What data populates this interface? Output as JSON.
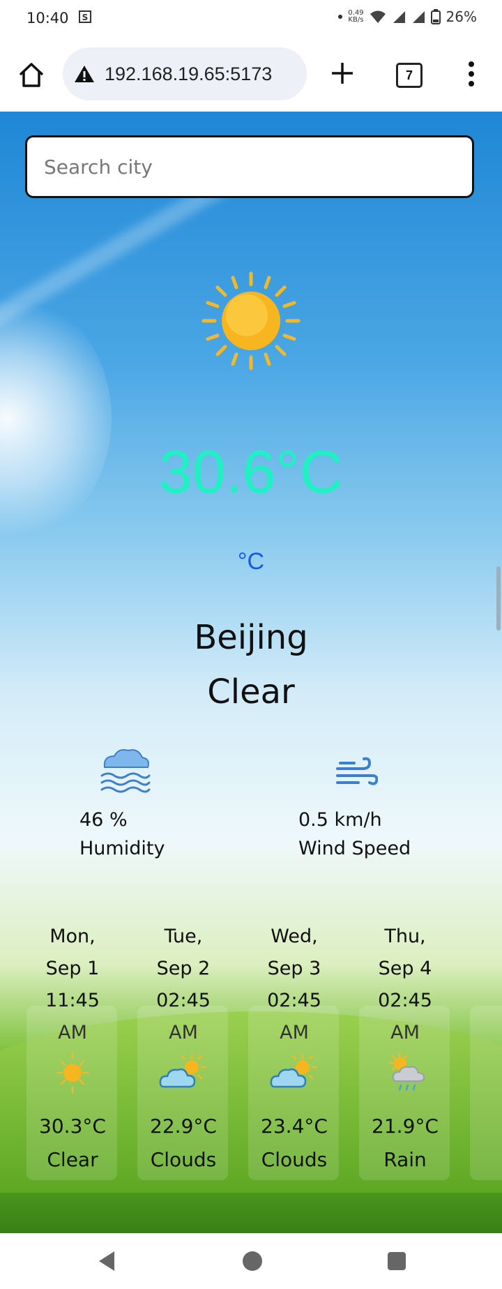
{
  "status_bar": {
    "time": "10:40",
    "net_speed": "0.49",
    "net_unit": "KB/s",
    "battery": "26%"
  },
  "browser": {
    "url": "192.168.19.65:5173",
    "tab_count": "7",
    "icons": [
      "home-icon",
      "warning-icon",
      "plus-icon",
      "tabs-icon",
      "menu-icon"
    ]
  },
  "search": {
    "placeholder": "Search city",
    "value": ""
  },
  "current": {
    "icon": "sun-icon",
    "temperature": "30.6°C",
    "unit_toggle": "°C",
    "city": "Beijing",
    "condition": "Clear",
    "temperature_color": "#1df2c2",
    "unit_color": "#1658e8"
  },
  "stats": {
    "humidity": {
      "icon": "humidity-icon",
      "value": "46 %",
      "label": "Humidity"
    },
    "wind": {
      "icon": "wind-icon",
      "value": "0.5 km/h",
      "label": "Wind Speed"
    }
  },
  "forecast": [
    {
      "day": "Mon,",
      "date": "Sep 1",
      "time": "11:45",
      "ampm": "AM",
      "icon": "sun-icon",
      "temp": "30.3°C",
      "condition": "Clear"
    },
    {
      "day": "Tue,",
      "date": "Sep 2",
      "time": "02:45",
      "ampm": "AM",
      "icon": "partly-cloudy-icon",
      "temp": "22.9°C",
      "condition": "Clouds"
    },
    {
      "day": "Wed,",
      "date": "Sep 3",
      "time": "02:45",
      "ampm": "AM",
      "icon": "partly-cloudy-icon",
      "temp": "23.4°C",
      "condition": "Clouds"
    },
    {
      "day": "Thu,",
      "date": "Sep 4",
      "time": "02:45",
      "ampm": "AM",
      "icon": "sun-rain-icon",
      "temp": "21.9°C",
      "condition": "Rain"
    }
  ]
}
